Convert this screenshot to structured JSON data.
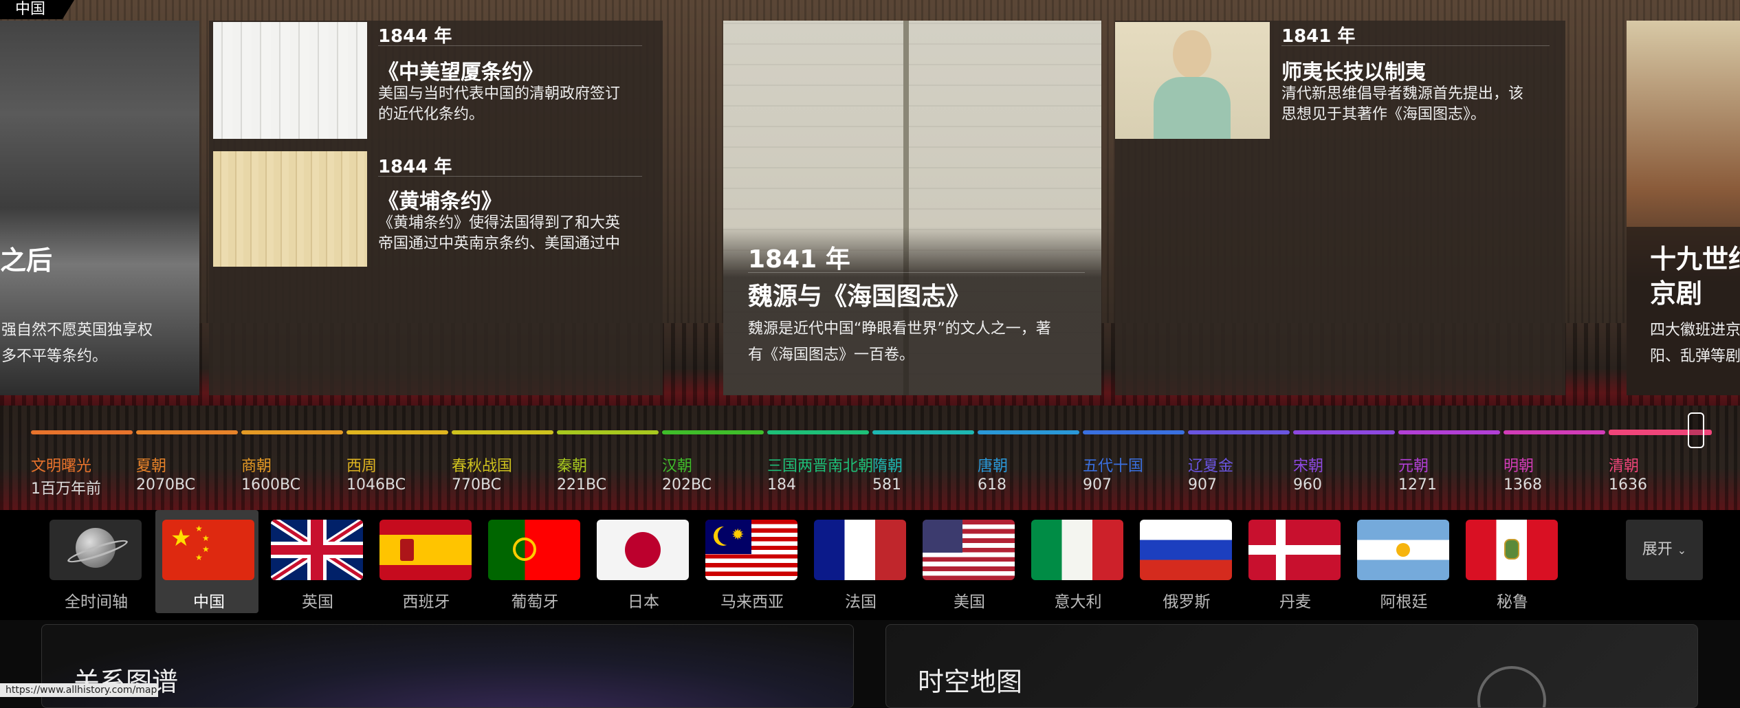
{
  "country_label": "中国",
  "hero": {
    "left_card": {
      "title": "之后",
      "desc": "强自然不愿英国独享权\n多不平等条约。"
    },
    "card_1844a": {
      "year": "1844 年",
      "title": "《中美望厦条约》",
      "desc": "美国与当时代表中国的清朝政府签订\n的近代化条约。"
    },
    "card_1844b": {
      "year": "1844 年",
      "title": "《黄埔条约》",
      "desc": "《黄埔条约》使得法国得到了和大英\n帝国通过中英南京条约、美国通过中"
    },
    "card_wei": {
      "year": "1841 年",
      "title": "魏源与《海国图志》",
      "desc": "魏源是近代中国“睁眼看世界”的文人之一，著\n有《海国图志》一百卷。"
    },
    "card_shiyi": {
      "year": "1841 年",
      "title": "师夷长技以制夷",
      "desc": "清代新思维倡导者魏源首先提出，该\n思想见于其著作《海国图志》。"
    },
    "right_card": {
      "title": "十九世纪\n京剧",
      "desc": "四大徽班进京\n阳、乱弹等剧"
    }
  },
  "timeline": {
    "eras": [
      {
        "name": "文明曙光",
        "year": "1百万年前",
        "color": "#e8732c"
      },
      {
        "name": "夏朝",
        "year": "2070BC",
        "color": "#e8832a"
      },
      {
        "name": "商朝",
        "year": "1600BC",
        "color": "#e59a25"
      },
      {
        "name": "西周",
        "year": "1046BC",
        "color": "#e0b520"
      },
      {
        "name": "春秋战国",
        "year": "770BC",
        "color": "#cfc21e"
      },
      {
        "name": "秦朝",
        "year": "221BC",
        "color": "#a8c81f"
      },
      {
        "name": "汉朝",
        "year": "202BC",
        "color": "#3fbd2a"
      },
      {
        "name": "三国两晋南北朝",
        "year": "184",
        "color": "#1ebf78"
      },
      {
        "name": "隋朝",
        "year": "581",
        "color": "#1eb7b2"
      },
      {
        "name": "唐朝",
        "year": "618",
        "color": "#2a98d8"
      },
      {
        "name": "五代十国",
        "year": "907",
        "color": "#3a70e0"
      },
      {
        "name": "辽夏金",
        "year": "907",
        "color": "#6a55e0"
      },
      {
        "name": "宋朝",
        "year": "960",
        "color": "#8d48e0"
      },
      {
        "name": "元朝",
        "year": "1271",
        "color": "#b23fd6"
      },
      {
        "name": "明朝",
        "year": "1368",
        "color": "#d23cb8"
      },
      {
        "name": "清朝",
        "year": "1636",
        "color": "#f0457a"
      }
    ]
  },
  "flags": [
    {
      "label": "全时间轴",
      "icon": "globe-icon"
    },
    {
      "label": "中国",
      "icon": "china-flag-icon",
      "selected": true
    },
    {
      "label": "英国",
      "icon": "uk-flag-icon"
    },
    {
      "label": "西班牙",
      "icon": "spain-flag-icon"
    },
    {
      "label": "葡萄牙",
      "icon": "portugal-flag-icon"
    },
    {
      "label": "日本",
      "icon": "japan-flag-icon"
    },
    {
      "label": "马来西亚",
      "icon": "malaysia-flag-icon"
    },
    {
      "label": "法国",
      "icon": "france-flag-icon"
    },
    {
      "label": "美国",
      "icon": "usa-flag-icon"
    },
    {
      "label": "意大利",
      "icon": "italy-flag-icon"
    },
    {
      "label": "俄罗斯",
      "icon": "russia-flag-icon"
    },
    {
      "label": "丹麦",
      "icon": "denmark-flag-icon"
    },
    {
      "label": "阿根廷",
      "icon": "argentina-flag-icon"
    },
    {
      "label": "秘鲁",
      "icon": "peru-flag-icon"
    }
  ],
  "expand_label": "展开",
  "panels": {
    "left_title": "关系图谱",
    "right_title": "时空地图"
  },
  "status_url": "https://www.allhistory.com/map"
}
